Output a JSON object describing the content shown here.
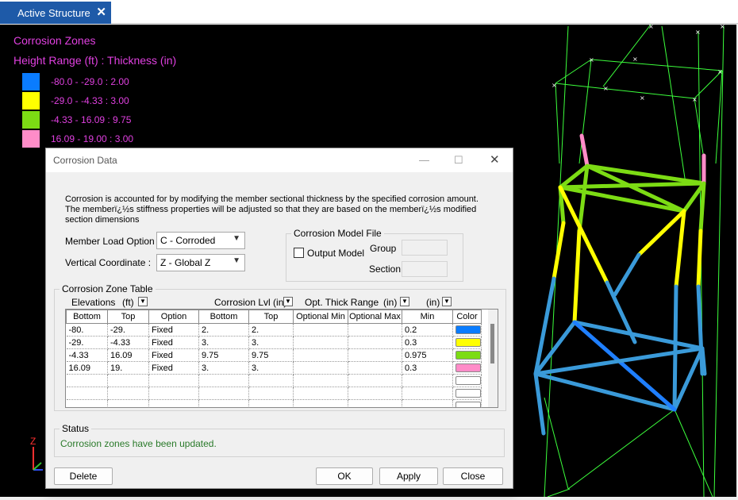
{
  "tab": {
    "title": "Active Structure",
    "close": "✕"
  },
  "viewport": {
    "legend_title": "Corrosion Zones",
    "legend_subtitle": "Height Range (ft) : Thickness (in)",
    "legend": [
      {
        "label": "-80.0 - -29.0 : 2.00",
        "color": "#0a7cff"
      },
      {
        "label": "-29.0 - -4.33 : 3.00",
        "color": "#ffff00"
      },
      {
        "label": "-4.33 - 16.09 : 9.75",
        "color": "#7cdc14"
      },
      {
        "label": "16.09 - 19.00 : 3.00",
        "color": "#ff8cc8"
      }
    ],
    "axis_z": "Z"
  },
  "dialog": {
    "title": "Corrosion Data",
    "description": "Corrosion is accounted for by modifying the member sectional thickness by the specified corrosion amount.  The memberï¿½s stiffness properties will be adjusted so that they are based on the memberï¿½s modified section dimensions",
    "member_load_option": {
      "label": "Member Load Option :",
      "value": "C - Corroded"
    },
    "vertical_coordinate": {
      "label": "Vertical Coordinate :",
      "value": "Z - Global Z"
    },
    "model_file": {
      "title": "Corrosion Model File",
      "output_model": "Output Model",
      "group": "Group",
      "section": "Section"
    },
    "zone_table": {
      "title": "Corrosion Zone Table",
      "elevations": "Elevations",
      "elev_unit": "(ft)",
      "lvl": "Corrosion Lvl  (in)",
      "opt_range": "Opt. Thick Range",
      "opt_unit1": "(in)",
      "opt_unit2": "(in)",
      "columns": [
        "Bottom",
        "Top",
        "Option",
        "Bottom",
        "Top",
        "Optional Min",
        "Optional Max",
        "Min",
        "Color"
      ],
      "rows": [
        {
          "bottom": "-80.",
          "top": "-29.",
          "option": "Fixed",
          "lbottom": "2.",
          "ltop": "2.",
          "omin": "",
          "omax": "",
          "min": "0.2",
          "color": "#0a7cff"
        },
        {
          "bottom": "-29.",
          "top": "-4.33",
          "option": "Fixed",
          "lbottom": "3.",
          "ltop": "3.",
          "omin": "",
          "omax": "",
          "min": "0.3",
          "color": "#ffff00"
        },
        {
          "bottom": "-4.33",
          "top": "16.09",
          "option": "Fixed",
          "lbottom": "9.75",
          "ltop": "9.75",
          "omin": "",
          "omax": "",
          "min": "0.975",
          "color": "#7cdc14"
        },
        {
          "bottom": "16.09",
          "top": "19.",
          "option": "Fixed",
          "lbottom": "3.",
          "ltop": "3.",
          "omin": "",
          "omax": "",
          "min": "0.3",
          "color": "#ff8cc8"
        }
      ]
    },
    "status": {
      "title": "Status",
      "message": "Corrosion zones have been updated."
    },
    "buttons": {
      "delete": "Delete",
      "ok": "OK",
      "apply": "Apply",
      "close": "Close"
    }
  }
}
